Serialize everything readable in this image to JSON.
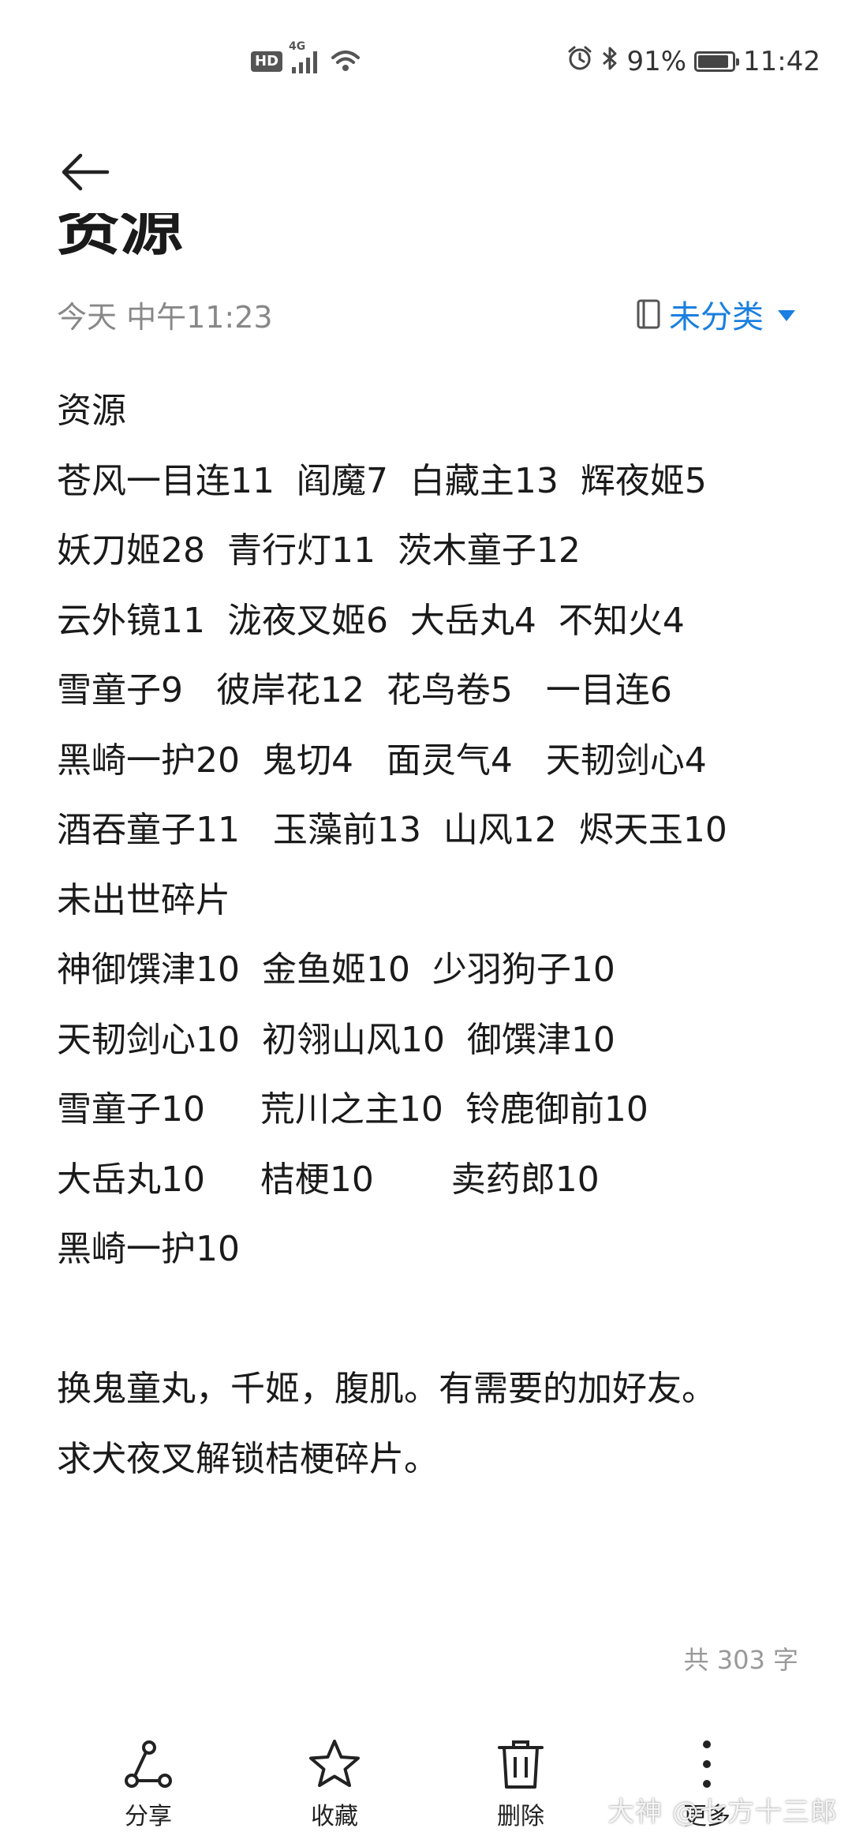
{
  "status_bar": {
    "hd_badge": "HD",
    "network": "4G",
    "battery_text": "91%",
    "battery_level": 0.91,
    "time": "11:42",
    "icons": [
      "signal-icon",
      "wifi-icon",
      "alarm-icon",
      "bluetooth-icon",
      "battery-icon"
    ]
  },
  "header": {
    "back_icon": "back-arrow-icon",
    "title": "资源",
    "timestamp": "今天 中午11:23",
    "category_label": "未分类",
    "category_icon": "notebook-icon",
    "accent_color": "#1a7fe0"
  },
  "body": {
    "lines": [
      "资源",
      "苍风一目连11  阎魔7  白藏主13  辉夜姬5",
      "妖刀姬28  青行灯11  茨木童子12",
      "云外镜11  泷夜叉姬6  大岳丸4  不知火4",
      "雪童子9   彼岸花12  花鸟卷5   一目连6",
      "黑崎一护20  鬼切4   面灵气4   天韧剑心4",
      "酒吞童子11   玉藻前13  山风12  烬天玉10",
      "未出世碎片",
      "神御馔津10  金鱼姬10  少羽狗子10",
      "天韧剑心10  初翎山风10  御馔津10",
      "雪童子10     荒川之主10  铃鹿御前10",
      "大岳丸10     桔梗10       卖药郎10",
      "黑崎一护10",
      "",
      "换鬼童丸，千姬，腹肌。有需要的加好友。",
      "求犬夜叉解锁桔梗碎片。"
    ],
    "word_count": "共 303 字"
  },
  "toolbar": {
    "share": {
      "label": "分享",
      "icon": "share-icon"
    },
    "favorite": {
      "label": "收藏",
      "icon": "star-icon"
    },
    "delete": {
      "label": "删除",
      "icon": "trash-icon"
    },
    "more": {
      "label": "更多",
      "icon": "more-vertical-icon"
    }
  },
  "watermark": "大神 @七方十三郎"
}
